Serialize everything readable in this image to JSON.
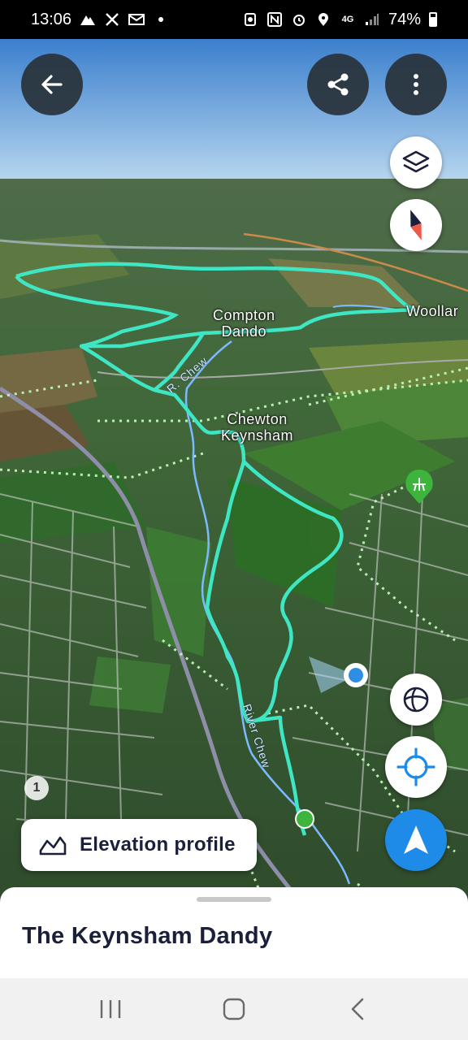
{
  "status_bar": {
    "time": "13:06",
    "battery": "74%",
    "left_icons": [
      "mountain-icon",
      "x-icon",
      "mail-icon",
      "dot-icon"
    ],
    "right_icons": [
      "recycle-icon",
      "nfc-icon",
      "alarm-icon",
      "location-icon",
      "4g-icon",
      "signal-icon",
      "battery-icon"
    ],
    "network": "4G"
  },
  "map": {
    "places": {
      "compton_dando": "Compton\nDando",
      "woollard": "Woollar",
      "chewton_keynsham": "Chewton\nKeynsham"
    },
    "rivers": {
      "upper": "R. Chew",
      "lower": "River Chew"
    },
    "route_color": "#3ee6c4",
    "river_color": "#7cb9ff",
    "footpath_color": "#b8f0b0"
  },
  "controls": {
    "back": "arrow-left-icon",
    "share": "share-icon",
    "more": "more-vertical-icon",
    "layers": "layers-icon",
    "compass": "compass-icon",
    "globe": "globe-icon",
    "locate": "crosshair-icon",
    "navigate": "navigation-arrow-icon",
    "info": "1"
  },
  "elevation": {
    "label": "Elevation profile",
    "icon": "elevation-chart-icon"
  },
  "sheet": {
    "title": "The Keynsham Dandy"
  },
  "accent_colors": {
    "navigate_button": "#1f8be8",
    "text_dark": "#1a1f3a",
    "poi_green": "#3db53d"
  }
}
